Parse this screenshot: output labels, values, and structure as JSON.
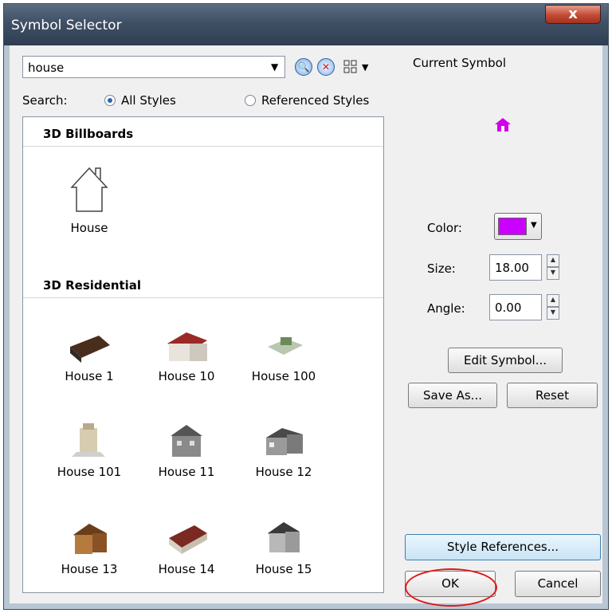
{
  "window": {
    "title": "Symbol Selector",
    "close_glyph": "x"
  },
  "search": {
    "value": "house",
    "label": "Search:",
    "option_all": "All Styles",
    "option_referenced": "Referenced Styles",
    "selected": "All Styles"
  },
  "categories": [
    {
      "name": "3D Billboards",
      "items": [
        "House"
      ]
    },
    {
      "name": "3D Residential",
      "items": [
        "House 1",
        "House 10",
        "House 100",
        "House 101",
        "House 11",
        "House 12",
        "House 13",
        "House 14",
        "House 15"
      ]
    }
  ],
  "current": {
    "label": "Current Symbol",
    "preview_color": "#d000e8",
    "color_label": "Color:",
    "color_value": "#cc00ff",
    "size_label": "Size:",
    "size_value": "18.00",
    "angle_label": "Angle:",
    "angle_value": "0.00"
  },
  "buttons": {
    "edit": "Edit Symbol...",
    "save": "Save As...",
    "reset": "Reset",
    "style_refs": "Style References...",
    "ok": "OK",
    "cancel": "Cancel"
  }
}
